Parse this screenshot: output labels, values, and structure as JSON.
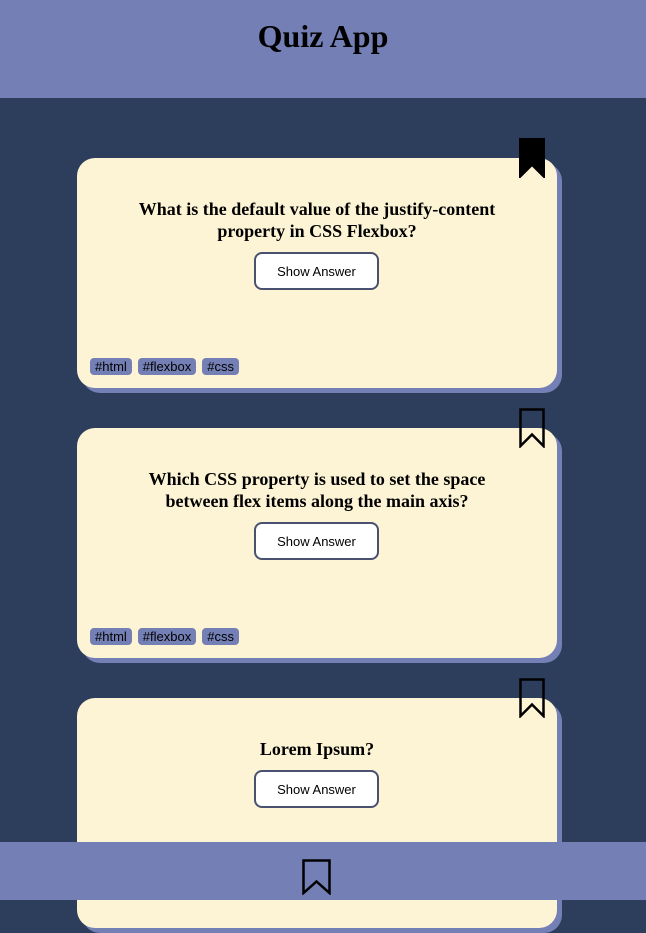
{
  "app": {
    "title": "Quiz App"
  },
  "colors": {
    "page_background": "#2c3e5c",
    "header_footer": "#7480b5",
    "card_background": "#fdf4d5",
    "tag_background": "#7480b5"
  },
  "cards": [
    {
      "question": "What is the default value of the justify-content property in CSS Flexbox?",
      "button_label": "Show Answer",
      "bookmarked": true,
      "bookmark_icon": "bookmark-filled-icon",
      "tags": [
        "#html",
        "#flexbox",
        "#css"
      ]
    },
    {
      "question": "Which CSS property is used to set the space between flex items along the main axis?",
      "button_label": "Show Answer",
      "bookmarked": false,
      "bookmark_icon": "bookmark-outline-icon",
      "tags": [
        "#html",
        "#flexbox",
        "#css"
      ]
    },
    {
      "question": "Lorem Ipsum?",
      "button_label": "Show Answer",
      "bookmarked": false,
      "bookmark_icon": "bookmark-outline-icon",
      "tags": []
    }
  ],
  "footer": {
    "nav_icon": "bookmark-outline-icon"
  }
}
